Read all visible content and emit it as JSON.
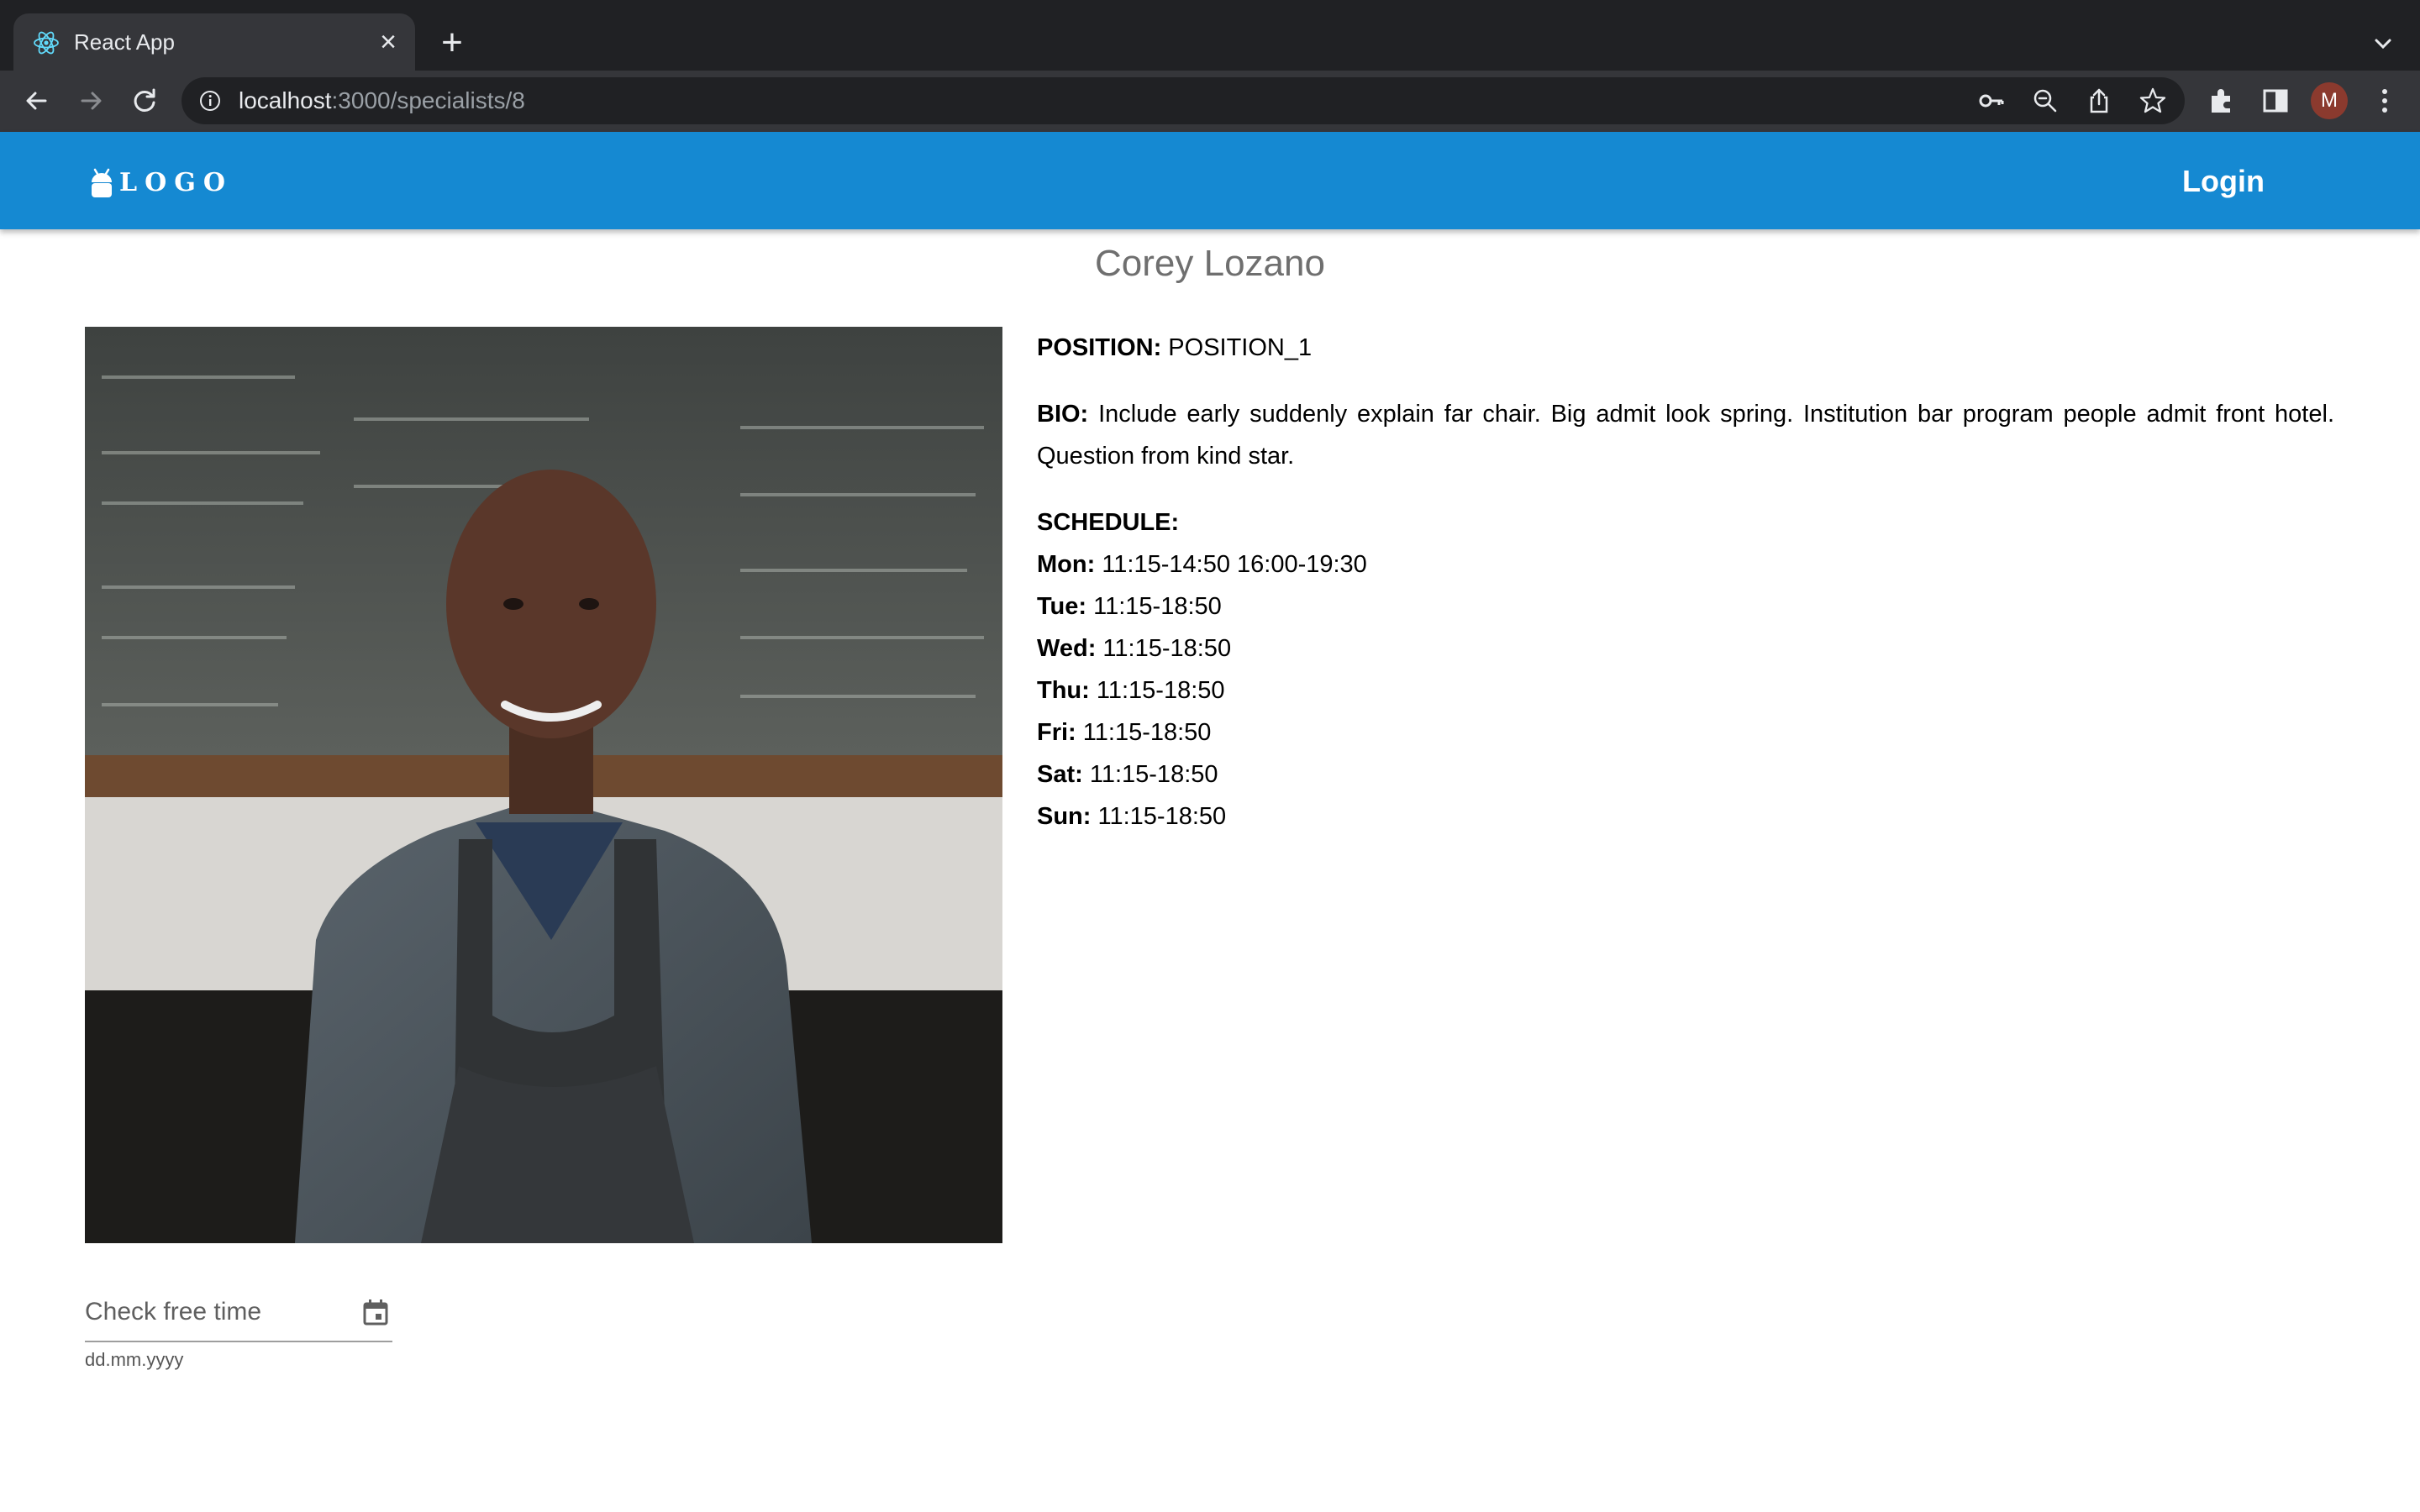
{
  "browser": {
    "tab": {
      "title": "React App",
      "favicon": "react-icon",
      "close": "×"
    },
    "new_tab": "+",
    "url": {
      "host": "localhost",
      "path": ":3000/specialists/8"
    },
    "avatar_initial": "M"
  },
  "appbar": {
    "logo_text": "LOGO",
    "login_label": "Login",
    "color": "#1589d2"
  },
  "specialist": {
    "name": "Corey Lozano",
    "position_label": "POSITION:",
    "position_value": "POSITION_1",
    "bio_label": "BIO:",
    "bio_text": "Include early suddenly explain far chair. Big admit look spring. Institution bar program people admit front hotel. Question from kind star.",
    "schedule_label": "SCHEDULE:",
    "schedule": [
      {
        "day": "Mon:",
        "hours": "11:15-14:50 16:00-19:30"
      },
      {
        "day": "Tue:",
        "hours": "11:15-18:50"
      },
      {
        "day": "Wed:",
        "hours": "11:15-18:50"
      },
      {
        "day": "Thu:",
        "hours": "11:15-18:50"
      },
      {
        "day": "Fri:",
        "hours": "11:15-18:50"
      },
      {
        "day": "Sat:",
        "hours": "11:15-18:50"
      },
      {
        "day": "Sun:",
        "hours": "11:15-18:50"
      }
    ]
  },
  "free_time": {
    "label": "Check free time",
    "helper": "dd.mm.yyyy",
    "icon": "calendar-icon"
  }
}
